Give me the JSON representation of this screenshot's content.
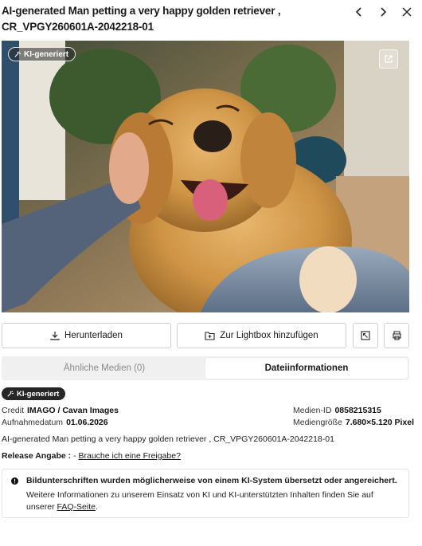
{
  "header": {
    "title": "AI-generated Man petting a very happy golden retriever , CR_VPGY260601A-2042218-01"
  },
  "image": {
    "ai_badge": "KI-generiert",
    "alt": "AI-generated Man petting a very happy golden retriever"
  },
  "actions": {
    "download_label": "Herunterladen",
    "lightbox_label": "Zur Lightbox hinzufügen"
  },
  "tabs": [
    {
      "label": "Ähnliche Medien (0)",
      "active": false
    },
    {
      "label": "Dateiinformationen",
      "active": true
    }
  ],
  "meta": {
    "ai_badge": "KI-generiert",
    "credit_label": "Credit",
    "credit_value": "IMAGO / Cavan Images",
    "date_label": "Aufnahmedatum",
    "date_value": "01.06.2026",
    "media_id_label": "Medien-ID",
    "media_id_value": "0858215315",
    "size_label": "Mediengröße",
    "size_value": "7.680×5.120 Pixel",
    "caption": "AI-generated Man petting a very happy golden retriever , CR_VPGY260601A-2042218-01",
    "release_label": "Release Angabe :",
    "release_dash": "-",
    "release_link": "Brauche ich eine Freigabe?"
  },
  "notice": {
    "title": "Bildunterschriften wurden möglicherweise von einem KI-System übersetzt oder angereichert.",
    "body": "Weitere Informationen zu unserem Einsatz von KI und KI-unterstützten Inhalten finden Sie auf unserer",
    "link": "FAQ-Seite",
    "after_link": "."
  }
}
